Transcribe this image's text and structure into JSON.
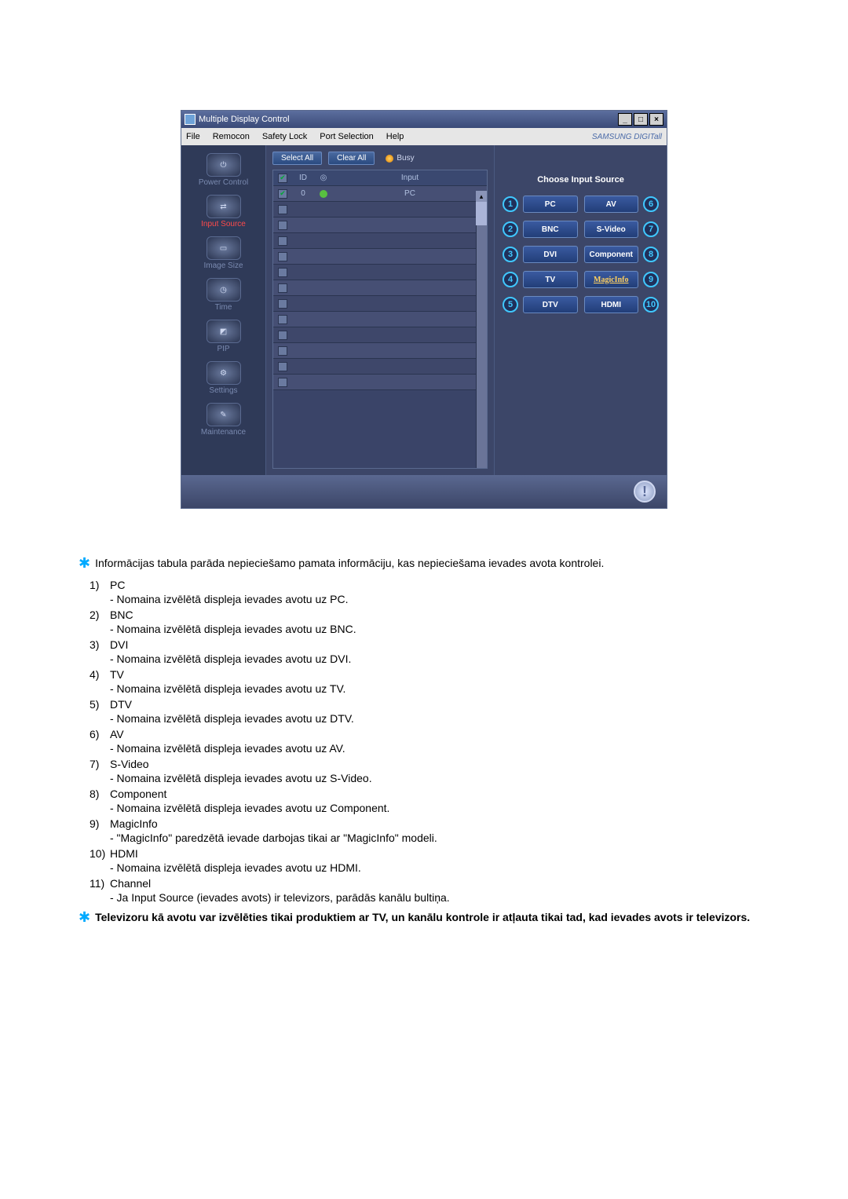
{
  "window": {
    "title": "Multiple Display Control",
    "menu": [
      "File",
      "Remocon",
      "Safety Lock",
      "Port Selection",
      "Help"
    ],
    "brand": "SAMSUNG DIGITall"
  },
  "sidebar": [
    {
      "label": "Power Control",
      "glyph": "⏻"
    },
    {
      "label": "Input Source",
      "glyph": "⇄",
      "selected": true
    },
    {
      "label": "Image Size",
      "glyph": "▭"
    },
    {
      "label": "Time",
      "glyph": "◷"
    },
    {
      "label": "PIP",
      "glyph": "◩"
    },
    {
      "label": "Settings",
      "glyph": "⚙"
    },
    {
      "label": "Maintenance",
      "glyph": "✎"
    }
  ],
  "buttons": {
    "select_all": "Select All",
    "clear_all": "Clear All",
    "busy": "Busy"
  },
  "grid": {
    "headers": {
      "id": "ID",
      "input": "Input"
    },
    "first_row": {
      "id": "0",
      "input": "PC"
    }
  },
  "right_panel": {
    "title": "Choose Input Source",
    "left_col": [
      {
        "n": "1",
        "label": "PC"
      },
      {
        "n": "2",
        "label": "BNC"
      },
      {
        "n": "3",
        "label": "DVI"
      },
      {
        "n": "4",
        "label": "TV"
      },
      {
        "n": "5",
        "label": "DTV"
      }
    ],
    "right_col": [
      {
        "n": "6",
        "label": "AV"
      },
      {
        "n": "7",
        "label": "S-Video"
      },
      {
        "n": "8",
        "label": "Component"
      },
      {
        "n": "9",
        "label": "MagicInfo",
        "magic": true
      },
      {
        "n": "10",
        "label": "HDMI"
      }
    ]
  },
  "doc": {
    "intro": "Informācijas tabula parāda nepieciešamo pamata informāciju, kas nepieciešama ievades avota kontrolei.",
    "items": [
      {
        "n": "1)",
        "title": "PC",
        "desc": "- Nomaina izvēlētā displeja ievades avotu uz PC."
      },
      {
        "n": "2)",
        "title": "BNC",
        "desc": "- Nomaina izvēlētā displeja ievades avotu uz BNC."
      },
      {
        "n": "3)",
        "title": "DVI",
        "desc": "- Nomaina izvēlētā displeja ievades avotu uz DVI."
      },
      {
        "n": "4)",
        "title": "TV",
        "desc": "- Nomaina izvēlētā displeja ievades avotu uz TV."
      },
      {
        "n": "5)",
        "title": "DTV",
        "desc": "- Nomaina izvēlētā displeja ievades avotu uz DTV."
      },
      {
        "n": "6)",
        "title": "AV",
        "desc": "- Nomaina izvēlētā displeja ievades avotu uz AV."
      },
      {
        "n": "7)",
        "title": "S-Video",
        "desc": "- Nomaina izvēlētā displeja ievades avotu uz S-Video."
      },
      {
        "n": "8)",
        "title": "Component",
        "desc": "- Nomaina izvēlētā displeja ievades avotu uz Component."
      },
      {
        "n": "9)",
        "title": "MagicInfo",
        "desc": "- \"MagicInfo\" paredzētā ievade darbojas tikai ar \"MagicInfo\" modeli."
      },
      {
        "n": "10)",
        "title": "HDMI",
        "desc": "- Nomaina izvēlētā displeja ievades avotu uz HDMI."
      },
      {
        "n": "11)",
        "title": "Channel",
        "desc": "- Ja Input Source (ievades avots) ir televizors, parādās kanālu bultiņa."
      }
    ],
    "outro": "Televizoru kā avotu var izvēlēties tikai produktiem ar TV, un kanālu kontrole ir atļauta tikai tad, kad ievades avots ir televizors."
  }
}
